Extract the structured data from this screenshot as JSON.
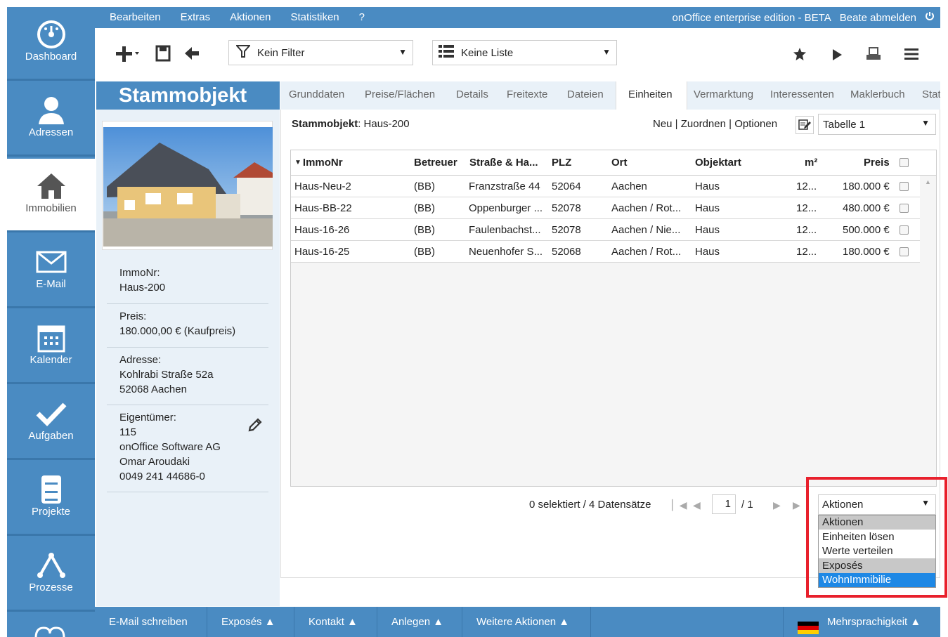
{
  "sidebar": {
    "items": [
      {
        "label": "Dashboard",
        "icon": "dashboard-gauge-icon"
      },
      {
        "label": "Adressen",
        "icon": "person-icon"
      },
      {
        "label": "Immobilien",
        "icon": "house-icon"
      },
      {
        "label": "E-Mail",
        "icon": "envelope-icon"
      },
      {
        "label": "Kalender",
        "icon": "calendar-icon"
      },
      {
        "label": "Aufgaben",
        "icon": "checkmark-icon"
      },
      {
        "label": "Projekte",
        "icon": "cabinet-icon"
      },
      {
        "label": "Prozesse",
        "icon": "process-icon"
      }
    ]
  },
  "topbar": {
    "menu": [
      "Bearbeiten",
      "Extras",
      "Aktionen",
      "Statistiken",
      "?"
    ],
    "edition": "onOffice enterprise edition - BETA",
    "logout": "Beate abmelden"
  },
  "toolbar": {
    "filter": "Kein Filter",
    "list": "Keine Liste"
  },
  "object": {
    "title": "Stammobjekt",
    "immonr_label": "ImmoNr:",
    "immonr": "Haus-200",
    "preis_label": "Preis:",
    "preis": "180.000,00 € (Kaufpreis)",
    "adresse_label": "Adresse:",
    "adresse_1": "Kohlrabi Straße 52a",
    "adresse_2": "52068 Aachen",
    "eigentuemer_label": "Eigentümer:",
    "eigentuemer_1": "115",
    "eigentuemer_2": "onOffice Software AG",
    "eigentuemer_3": "Omar Aroudaki",
    "eigentuemer_4": "0049 241 44686-0"
  },
  "tabs": [
    "Grunddaten",
    "Preise/Flächen",
    "Details",
    "Freitexte",
    "Dateien",
    "Einheiten",
    "Vermarktung",
    "Interessenten",
    "Maklerbuch",
    "Stat"
  ],
  "main": {
    "header_label": "Stammobjekt",
    "header_value": ": Haus-200",
    "links": "Neu | Zuordnen | Optionen",
    "table_select": "Tabelle 1",
    "columns": [
      "ImmoNr",
      "Betreuer",
      "Straße & Ha...",
      "PLZ",
      "Ort",
      "Objektart",
      "m²",
      "Preis"
    ],
    "rows": [
      [
        "Haus-Neu-2",
        "(BB)",
        "Franzstraße 44",
        "52064",
        "Aachen",
        "Haus",
        "12...",
        "180.000 €"
      ],
      [
        "Haus-BB-22",
        "(BB)",
        "Oppenburger ...",
        "52078",
        "Aachen / Rot...",
        "Haus",
        "12...",
        "480.000 €"
      ],
      [
        "Haus-16-26",
        "(BB)",
        "Faulenbachst...",
        "52078",
        "Aachen / Nie...",
        "Haus",
        "12...",
        "500.000 €"
      ],
      [
        "Haus-16-25",
        "(BB)",
        "Neuenhofer S...",
        "52068",
        "Aachen / Rot...",
        "Haus",
        "12...",
        "180.000 €"
      ]
    ],
    "selection": "0 selektiert / 4 Datensätze",
    "page": "1",
    "page_total": "/ 1",
    "actions_select": "Aktionen",
    "actions_options": [
      "Aktionen",
      "Einheiten lösen",
      "Werte verteilen",
      "Exposés",
      "WohnImmibilie"
    ]
  },
  "bottombar": {
    "items": [
      "E-Mail schreiben",
      "Exposés ▲",
      "Kontakt ▲",
      "Anlegen ▲",
      "Weitere Aktionen ▲"
    ],
    "language": "Mehrsprachigkeit ▲"
  },
  "colors": {
    "brand": "#4a8bc2",
    "highlight": "#1e88e5",
    "alert": "#e8202c"
  }
}
